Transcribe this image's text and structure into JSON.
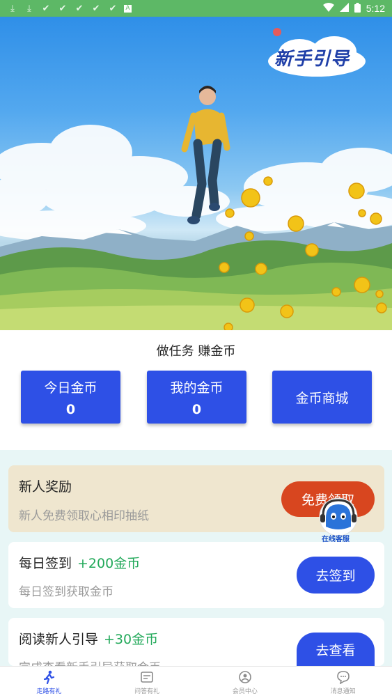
{
  "status_bar": {
    "time": "5:12",
    "left_icons": [
      "download-icon",
      "download-icon",
      "check-icon",
      "check-icon",
      "check-icon",
      "check-icon",
      "check-icon",
      "font-icon"
    ]
  },
  "hero": {
    "badge_text": "新手引导"
  },
  "section_title": "做任务 赚金币",
  "stats": [
    {
      "label": "今日金币",
      "value": "0"
    },
    {
      "label": "我的金币",
      "value": "0"
    },
    {
      "label": "金币商城"
    }
  ],
  "tasks": [
    {
      "title": "新人奖励",
      "reward": "",
      "subtitle": "新人免费领取心相印抽纸",
      "button": "免费领取",
      "button_color": "#d8461f"
    },
    {
      "title": "每日签到",
      "reward": "+200金币",
      "subtitle": "每日签到获取金币",
      "button": "去签到",
      "button_color": "#2e50e6"
    },
    {
      "title": "阅读新人引导",
      "reward": "+30金币",
      "subtitle": "完成查看新手引导获取金币",
      "button": "去查看",
      "button_color": "#2e50e6"
    }
  ],
  "customer_service": {
    "label": "在线客服"
  },
  "bottom_nav": [
    {
      "label": "走路有礼",
      "icon": "runner-icon",
      "active": true
    },
    {
      "label": "问答有礼",
      "icon": "qa-icon",
      "active": false
    },
    {
      "label": "会员中心",
      "icon": "member-icon",
      "active": false
    },
    {
      "label": "消息通知",
      "icon": "message-icon",
      "active": false
    }
  ],
  "colors": {
    "primary": "#2e50e6",
    "reward": "#22a95a",
    "claim": "#d8461f",
    "status_bar": "#5db866"
  }
}
